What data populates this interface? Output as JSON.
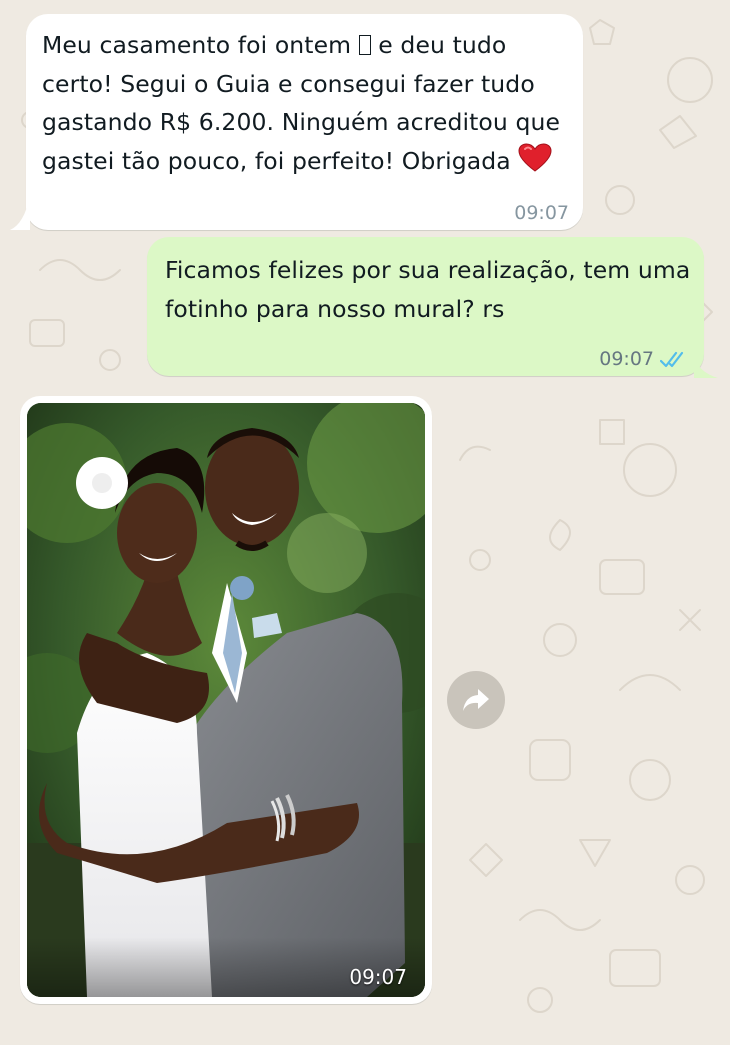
{
  "chat": {
    "messages": [
      {
        "direction": "incoming",
        "text_before_emoji": "Meu casamento foi ontem ",
        "missing_emoji": "▯",
        "text_after_emoji": " e deu tudo certo! Segui o Guia e consegui fazer tudo gastando R$ 6.200. Ninguém acreditou que gastei tão pouco, foi perfeito! Obrigada ",
        "trailing_icon": "heart-icon",
        "time": "09:07"
      },
      {
        "direction": "outgoing",
        "text": "Ficamos felizes por sua realização, tem uma fotinho para nosso mural? rs",
        "time": "09:07",
        "status_icon": "double-check-icon",
        "status_color": "#53bdeb"
      },
      {
        "direction": "incoming",
        "type": "image",
        "image_description_icon": "wedding-photo",
        "time": "09:07"
      }
    ],
    "forward_icon": "forward-arrow-icon"
  },
  "colors": {
    "wallpaper": "#efeae2",
    "incoming_bubble": "#ffffff",
    "outgoing_bubble": "#dcf8c6",
    "read_ticks": "#53bdeb",
    "heart": "#e0202c"
  }
}
